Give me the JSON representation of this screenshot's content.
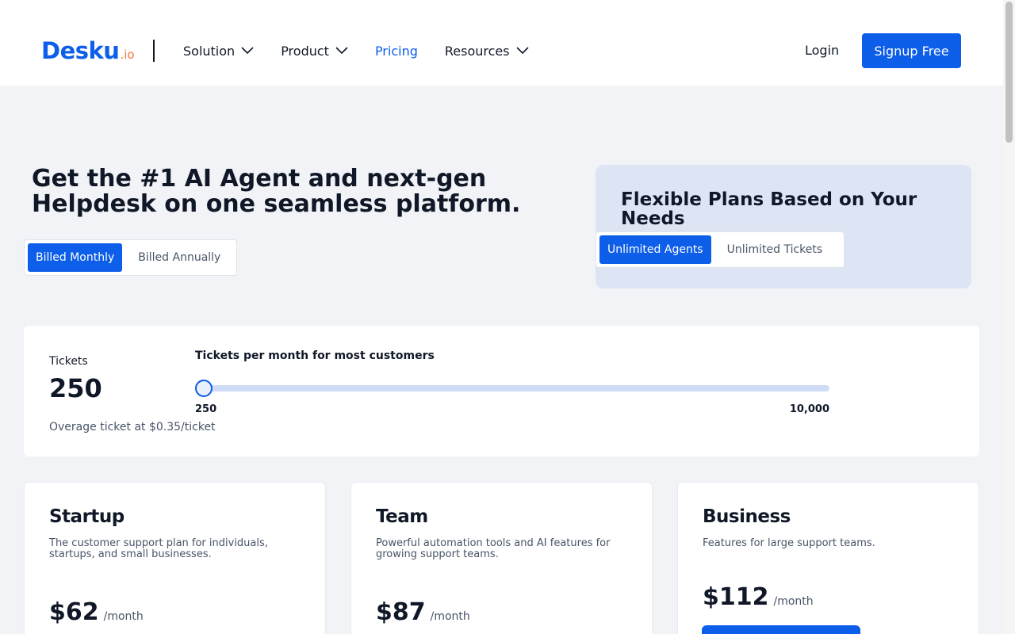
{
  "header": {
    "logo_main": "Desku",
    "logo_suffix": ".io",
    "nav": [
      {
        "label": "Solution",
        "has_dropdown": true
      },
      {
        "label": "Product",
        "has_dropdown": true
      },
      {
        "label": "Pricing",
        "active": true
      },
      {
        "label": "Resources",
        "has_dropdown": true
      }
    ],
    "login_label": "Login",
    "signup_label": "Signup Free"
  },
  "hero": {
    "title": "Get the #1 AI Agent and next-gen Helpdesk on one seamless platform.",
    "billing_options": [
      "Billed Monthly",
      "Billed Annually"
    ],
    "billing_selected": "Billed Monthly"
  },
  "plans_box": {
    "title": "Flexible Plans Based on Your Needs",
    "options": [
      "Unlimited Agents",
      "Unlimited Tickets"
    ],
    "selected": "Unlimited Agents"
  },
  "tickets": {
    "label": "Tickets",
    "value": "250",
    "overage": "Overage ticket at $0.35/ticket",
    "caption": "Tickets per month for most customers",
    "slider": {
      "min": 250,
      "max": 10000,
      "current": 250,
      "min_label": "250",
      "max_label": "10,000"
    }
  },
  "plans": [
    {
      "name": "Startup",
      "description": "The customer support plan for individuals, startups, and small businesses.",
      "price": "$62",
      "period": "/month"
    },
    {
      "name": "Team",
      "description": "Powerful automation tools and AI features for growing support teams.",
      "price": "$87",
      "period": "/month"
    },
    {
      "name": "Business",
      "description": "Features for large support teams.",
      "price": "$112",
      "period": "/month"
    }
  ],
  "colors": {
    "brand_blue": "#0d5ee8",
    "logo_accent": "#f07b3a",
    "page_bg": "#f2f3f7",
    "plans_box_bg": "#dde4f4"
  }
}
